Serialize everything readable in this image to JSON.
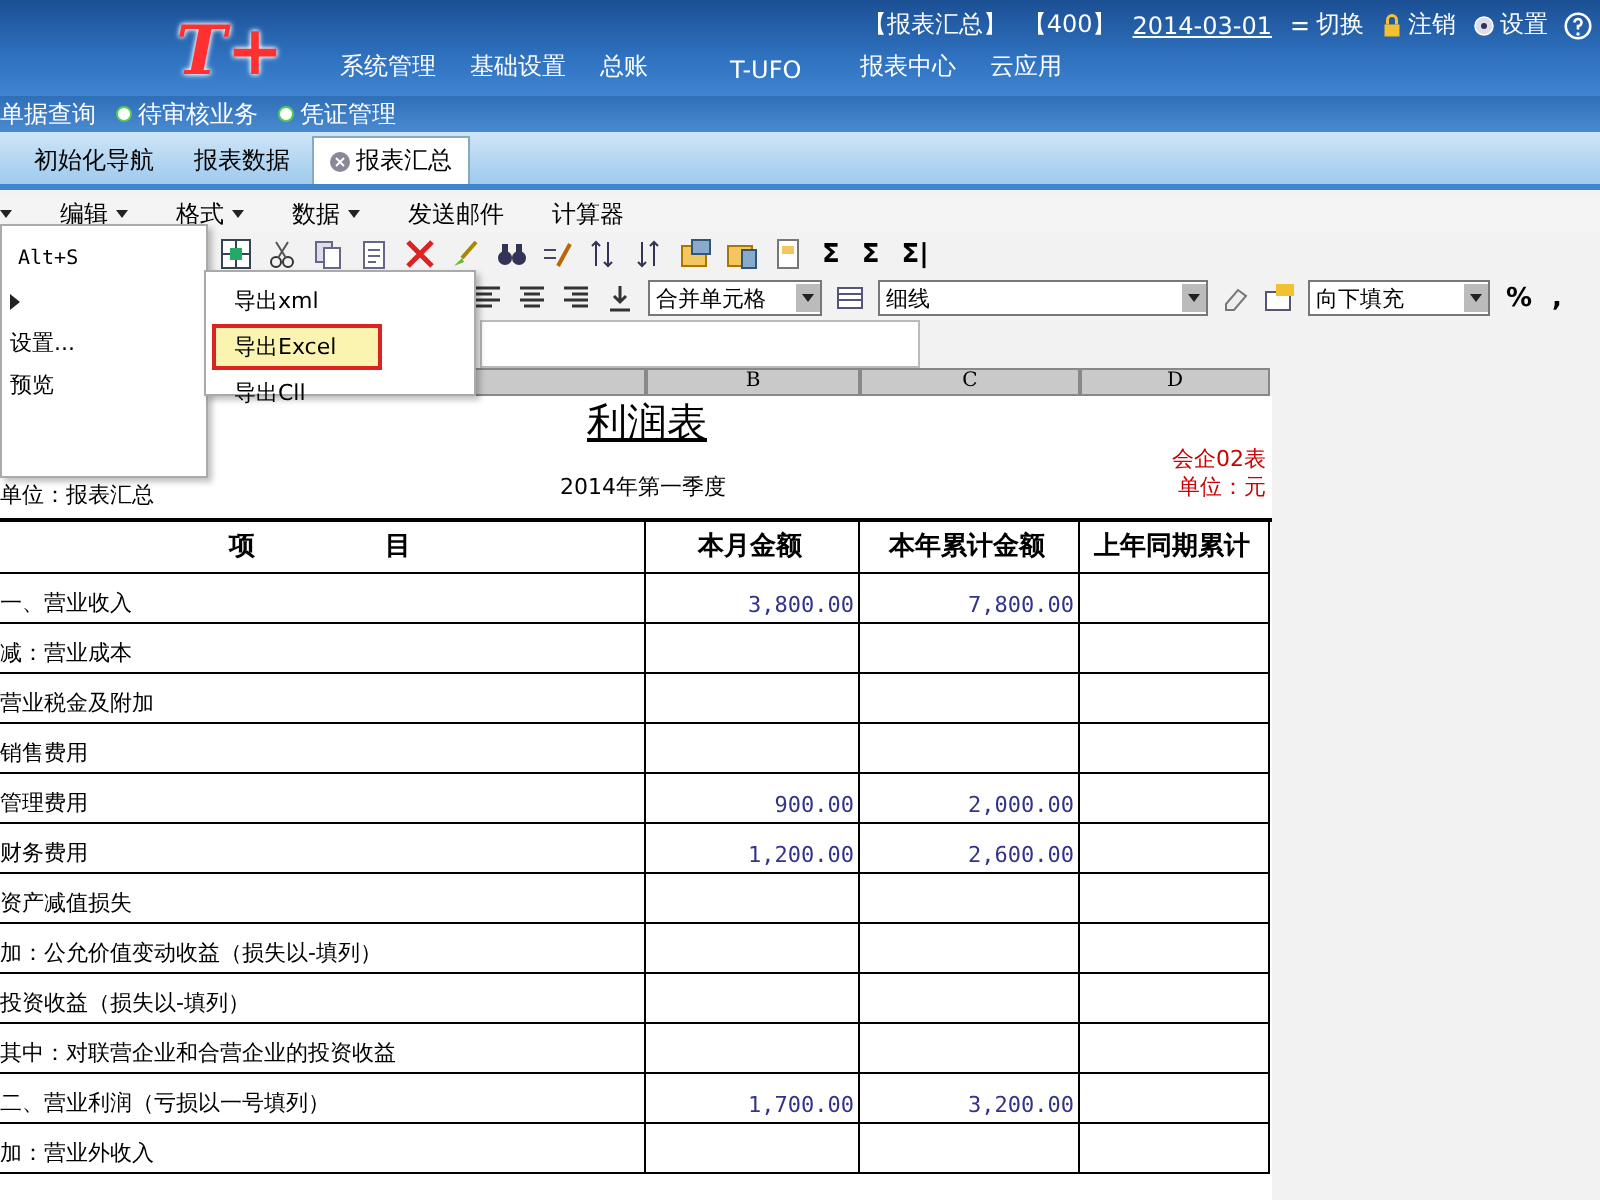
{
  "header": {
    "logo": "T+",
    "context": "【报表汇总】",
    "account": "【400】",
    "date": "2014-03-01",
    "actions": [
      {
        "kind": "switch",
        "label": "切换"
      },
      {
        "kind": "logout",
        "label": "注销"
      },
      {
        "kind": "settings",
        "label": "设置"
      }
    ]
  },
  "nav": [
    "系统管理",
    "基础设置",
    "总账",
    "T-UFO",
    "报表中心",
    "云应用"
  ],
  "quick_links": [
    {
      "label": "单据查询",
      "bullet": false
    },
    {
      "label": "待审核业务",
      "bullet": true
    },
    {
      "label": "凭证管理",
      "bullet": true
    }
  ],
  "tabs": [
    {
      "label": "初始化导航",
      "selected": false,
      "closable": false
    },
    {
      "label": "报表数据",
      "selected": false,
      "closable": false
    },
    {
      "label": "报表汇总",
      "selected": true,
      "closable": true
    }
  ],
  "menubar": [
    {
      "dropdown": true
    },
    {
      "label": "编辑",
      "dropdown": true
    },
    {
      "label": "格式",
      "dropdown": true
    },
    {
      "label": "数据",
      "dropdown": true
    },
    {
      "label": "发送邮件",
      "dropdown": false
    },
    {
      "label": "计算器",
      "dropdown": false
    }
  ],
  "toolbar": {
    "sum_symbols": [
      "Σ",
      "Σ",
      "Σ|"
    ],
    "combos": [
      {
        "value": "合并单元格"
      },
      {
        "value": "细线"
      },
      {
        "value": "向下填充"
      }
    ],
    "symbols": [
      "%",
      ","
    ]
  },
  "sheet": {
    "columns": [
      "B",
      "C",
      "D"
    ],
    "title": "利润表",
    "form_code": "会企02表",
    "unit_left": "单位：报表汇总",
    "period": "2014年第一季度",
    "unit_right": "单位：元",
    "headers": [
      "项　　　　　目",
      "本月金额",
      "本年累计金额",
      "上年同期累计"
    ],
    "rows": [
      {
        "item": "一、营业收入",
        "month": "3,800.00",
        "year": "7,800.00"
      },
      {
        "item": "减：营业成本"
      },
      {
        "item": "营业税金及附加"
      },
      {
        "item": "销售费用"
      },
      {
        "item": "管理费用",
        "month": "900.00",
        "year": "2,000.00"
      },
      {
        "item": "财务费用",
        "month": "1,200.00",
        "year": "2,600.00"
      },
      {
        "item": "资产减值损失"
      },
      {
        "item": "加：公允价值变动收益（损失以-填列）"
      },
      {
        "item": "投资收益（损失以-填列）"
      },
      {
        "item": "其中：对联营企业和合营企业的投资收益"
      },
      {
        "item": "二、营业利润（亏损以一号填列）",
        "month": "1,700.00",
        "year": "3,200.00"
      },
      {
        "item": "加：营业外收入"
      }
    ]
  },
  "file_menu": {
    "items": [
      {
        "kind": "shortcut",
        "label": "Alt+S"
      },
      {
        "kind": "submenu"
      },
      {
        "kind": "text",
        "label": "设置..."
      },
      {
        "kind": "text",
        "label": "预览"
      }
    ]
  },
  "export_menu": {
    "items": [
      {
        "label": "导出xml",
        "selected": false
      },
      {
        "label": "导出Excel",
        "selected": true
      },
      {
        "label": "导出Cll",
        "selected": false
      }
    ]
  }
}
